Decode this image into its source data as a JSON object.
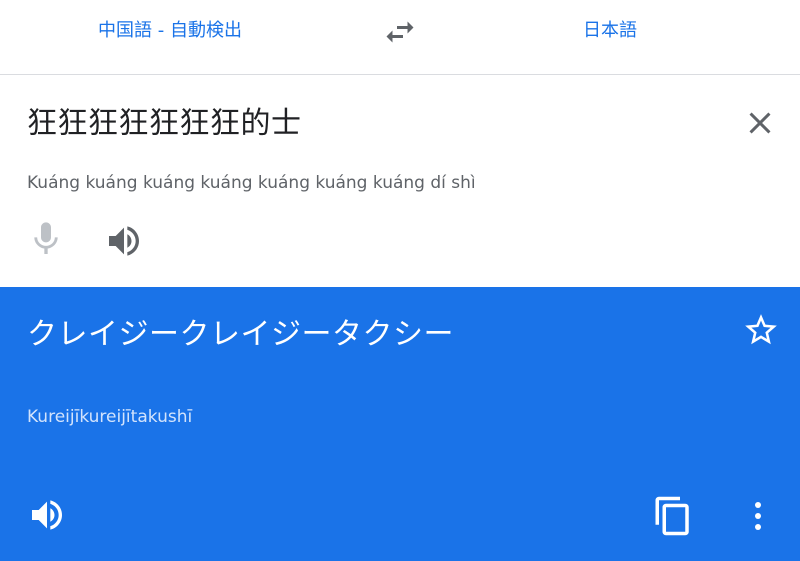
{
  "language_bar": {
    "source_language": "中国語 - 自動検出",
    "target_language": "日本語",
    "swap_icon": "swap-arrows-icon"
  },
  "source": {
    "text": "狂狂狂狂狂狂狂的士",
    "pinyin": "Kuáng kuáng kuáng kuáng kuáng kuáng kuáng dí shì",
    "icons": {
      "clear": "close-icon",
      "mic": "microphone-icon",
      "speaker": "speaker-icon"
    }
  },
  "result": {
    "text": "クレイジークレイジータクシー",
    "romaji": "Kureijīkureijītakushī",
    "icons": {
      "star": "star-outline-icon",
      "speaker": "speaker-icon",
      "copy": "copy-icon",
      "more": "more-vertical-icon"
    }
  },
  "colors": {
    "accent": "#1a73e8",
    "result_background": "#1a73e8",
    "text_primary": "#202124",
    "text_secondary": "#5f6368",
    "icon_gray": "#5f6368",
    "icon_disabled": "#bdc1c6",
    "result_secondary_text": "#d2e3fc"
  }
}
